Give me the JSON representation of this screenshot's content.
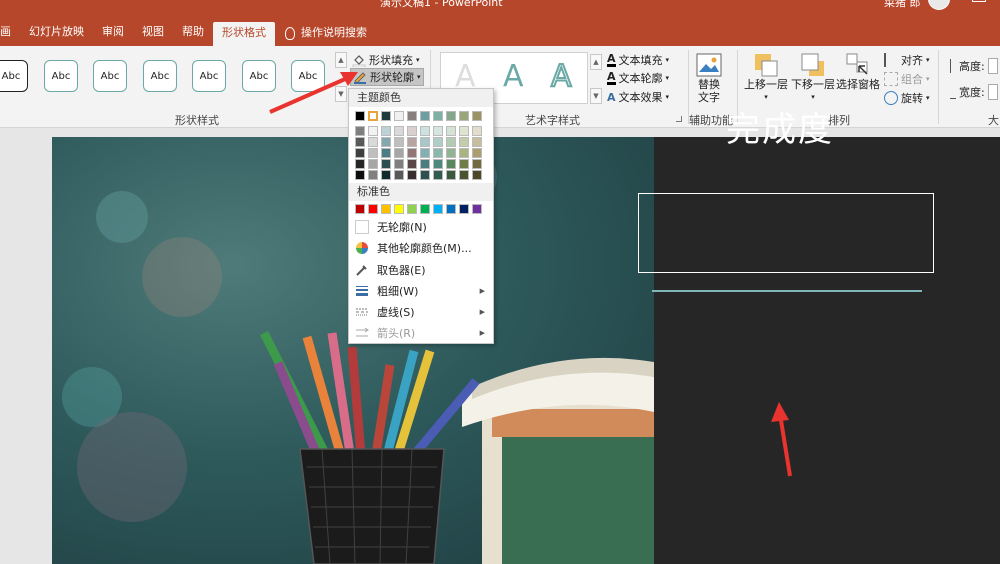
{
  "window": {
    "title": "演示文稿1 - PowerPoint",
    "user": "菜猪 郎"
  },
  "tabs": [
    {
      "label": "画"
    },
    {
      "label": "幻灯片放映"
    },
    {
      "label": "审阅"
    },
    {
      "label": "视图"
    },
    {
      "label": "帮助"
    },
    {
      "label": "形状格式",
      "active": true
    }
  ],
  "tell_me": "操作说明搜索",
  "shape_styles": {
    "group_label": "形状样式",
    "thumbnail_label": "Abc",
    "fill_label": "形状填充",
    "outline_label": "形状轮廓"
  },
  "wordart_styles": {
    "group_label": "艺术字样式",
    "sample": "A",
    "text_fill": "文本填充",
    "text_outline": "文本轮廓",
    "text_effects": "文本效果"
  },
  "accessibility": {
    "group_label": "辅助功能",
    "alt_text_line1": "替换",
    "alt_text_line2": "文字"
  },
  "arrange": {
    "group_label": "排列",
    "bring_forward": "上移一层",
    "send_backward": "下移一层",
    "selection_pane": "选择窗格",
    "align": "对齐",
    "group": "组合",
    "rotate": "旋转"
  },
  "size": {
    "height_label": "高度:",
    "width_label": "宽度:",
    "group_label_partial": "大"
  },
  "outline_menu": {
    "theme_colors_label": "主题颜色",
    "standard_colors_label": "标准色",
    "no_outline": "无轮廓(N)",
    "more_colors": "其他轮廓颜色(M)...",
    "eyedropper": "取色器(E)",
    "weight": "粗细(W)",
    "dashes": "虚线(S)",
    "arrows": "箭头(R)",
    "theme_colors": [
      [
        "#000000",
        "#ffffff",
        "#1f3a3d",
        "#f0f0f0",
        "#8a7f7f",
        "#6d9ea1",
        "#7fb0a4",
        "#86a88a",
        "#9aa67a",
        "#9b9265"
      ],
      [
        "#7f7f7f",
        "#f2f2f2",
        "#bcd2d4",
        "#d9d9d9",
        "#dbcfcf",
        "#cfe0e1",
        "#d5e6e1",
        "#d5e3d6",
        "#dfe4d0",
        "#e2ddcd"
      ],
      [
        "#595959",
        "#d9d9d9",
        "#84a9ad",
        "#bfbfbf",
        "#b8a3a3",
        "#a9c7c9",
        "#afcfc6",
        "#b1ccb3",
        "#c4ccaa",
        "#c7be9f"
      ],
      [
        "#3f3f3f",
        "#bfbfbf",
        "#4b7d82",
        "#a6a6a6",
        "#937676",
        "#82b0b3",
        "#8ab8ab",
        "#8fb592",
        "#a9b481",
        "#ab9f70"
      ],
      [
        "#262626",
        "#a6a6a6",
        "#2a4f53",
        "#7f7f7f",
        "#5a4848",
        "#4a7d80",
        "#4d8a7c",
        "#5a8860",
        "#6f7c48",
        "#736a40"
      ],
      [
        "#0d0d0d",
        "#7f7f7f",
        "#152a2c",
        "#595959",
        "#3a2f2f",
        "#2e5053",
        "#315a50",
        "#3a5a3e",
        "#4a532f",
        "#4d472a"
      ]
    ],
    "standard_colors": [
      "#c00000",
      "#ff0000",
      "#ffc000",
      "#ffff00",
      "#92d050",
      "#00b050",
      "#00b0f0",
      "#0070c0",
      "#002060",
      "#7030a0"
    ]
  },
  "slide": {
    "title": "完成度"
  },
  "colors": {
    "accent": "#b7472a",
    "annotation_arrow": "#e8332e"
  }
}
